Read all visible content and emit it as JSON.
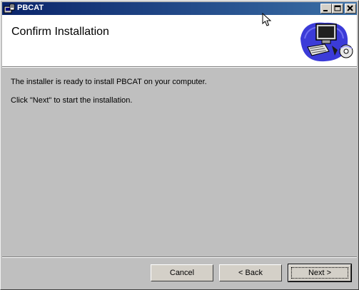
{
  "window": {
    "title": "PBCAT",
    "minimize_icon": "minimize-icon",
    "maximize_icon": "maximize-icon",
    "close_icon": "close-icon"
  },
  "header": {
    "title": "Confirm Installation",
    "icon": "computer-install-icon"
  },
  "content": {
    "line1": "The installer is ready to install PBCAT on your computer.",
    "line2": "Click \"Next\" to start the installation."
  },
  "buttons": {
    "cancel": "Cancel",
    "back": "< Back",
    "next": "Next >"
  },
  "colors": {
    "titlebar_start": "#0a246a",
    "titlebar_end": "#3a6ea5",
    "background": "#bfbfbf"
  }
}
